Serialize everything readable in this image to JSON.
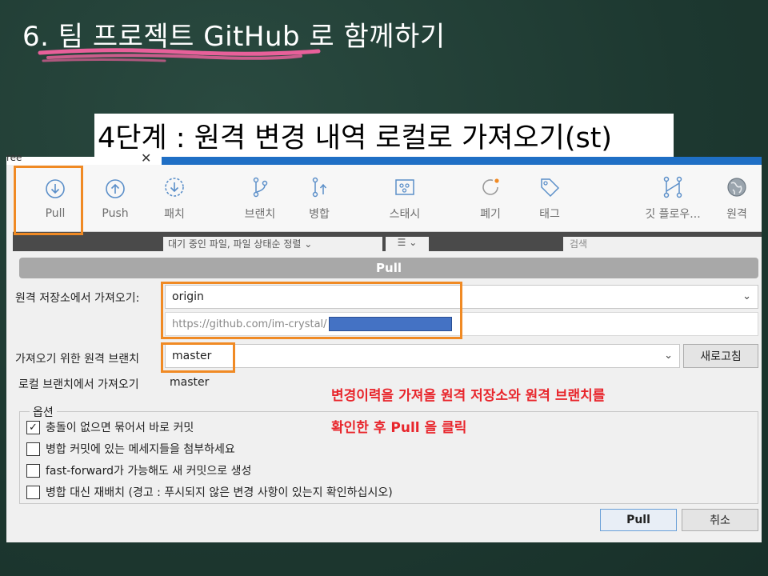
{
  "slide": {
    "title": "6. 팀 프로젝트 GitHub 로 함께하기",
    "step_caption": "4단계 : 원격 변경 내역 로컬로 가져오기(st)"
  },
  "window": {
    "title_fragment": "ree",
    "close_glyph": "✕"
  },
  "toolbar": {
    "items": [
      {
        "label": "Pull",
        "icon": "pull-icon"
      },
      {
        "label": "Push",
        "icon": "push-icon"
      },
      {
        "label": "패치",
        "icon": "patch-icon"
      },
      {
        "label": "브랜치",
        "icon": "branch-icon"
      },
      {
        "label": "병합",
        "icon": "merge-icon"
      },
      {
        "label": "스태시",
        "icon": "stash-icon"
      },
      {
        "label": "폐기",
        "icon": "discard-icon"
      },
      {
        "label": "태그",
        "icon": "tag-icon"
      },
      {
        "label": "깃 플로우...",
        "icon": "git-flow-icon"
      },
      {
        "label": "원격",
        "icon": "remote-globe-icon"
      }
    ]
  },
  "filter_bar": {
    "file_filter": "대기 중인 파일, 파일 상태순 정렬 ⌄",
    "view_toggle": "☰ ⌄",
    "search_placeholder": "검색"
  },
  "dialog": {
    "title": "Pull",
    "remote_label": "원격 저장소에서 가져오기:",
    "remote_value": "origin",
    "remote_url": "https://github.com/im-crystal/",
    "branch_label": "가져오기 위한 원격 브랜치",
    "branch_value": "master",
    "refresh_button": "새로고침",
    "local_branch_label": "로컬 브랜치에서 가져오기",
    "local_branch_value": "master",
    "options_legend": "옵션",
    "options": [
      {
        "label": "충돌이 없으면 묶어서 바로 커밋",
        "checked": true
      },
      {
        "label": "병합 커밋에 있는 메세지들을 첨부하세요",
        "checked": false
      },
      {
        "label": "fast-forward가 가능해도 새 커밋으로 생성",
        "checked": false
      },
      {
        "label": "병합 대신 재배치 (경고 : 푸시되지 않은 변경 사항이 있는지 확인하십시오)",
        "checked": false
      }
    ],
    "ok_button": "Pull",
    "cancel_button": "취소"
  },
  "annotation": {
    "line1": "변경이력을 가져올 원격 저장소와 원격 브랜치를",
    "line2": "확인한 후 Pull 을 클릭",
    "color": "#e8262c"
  },
  "colors": {
    "highlight": "#f08a24",
    "chalk_underline": "#e8609a",
    "board": "#1f3a32"
  }
}
